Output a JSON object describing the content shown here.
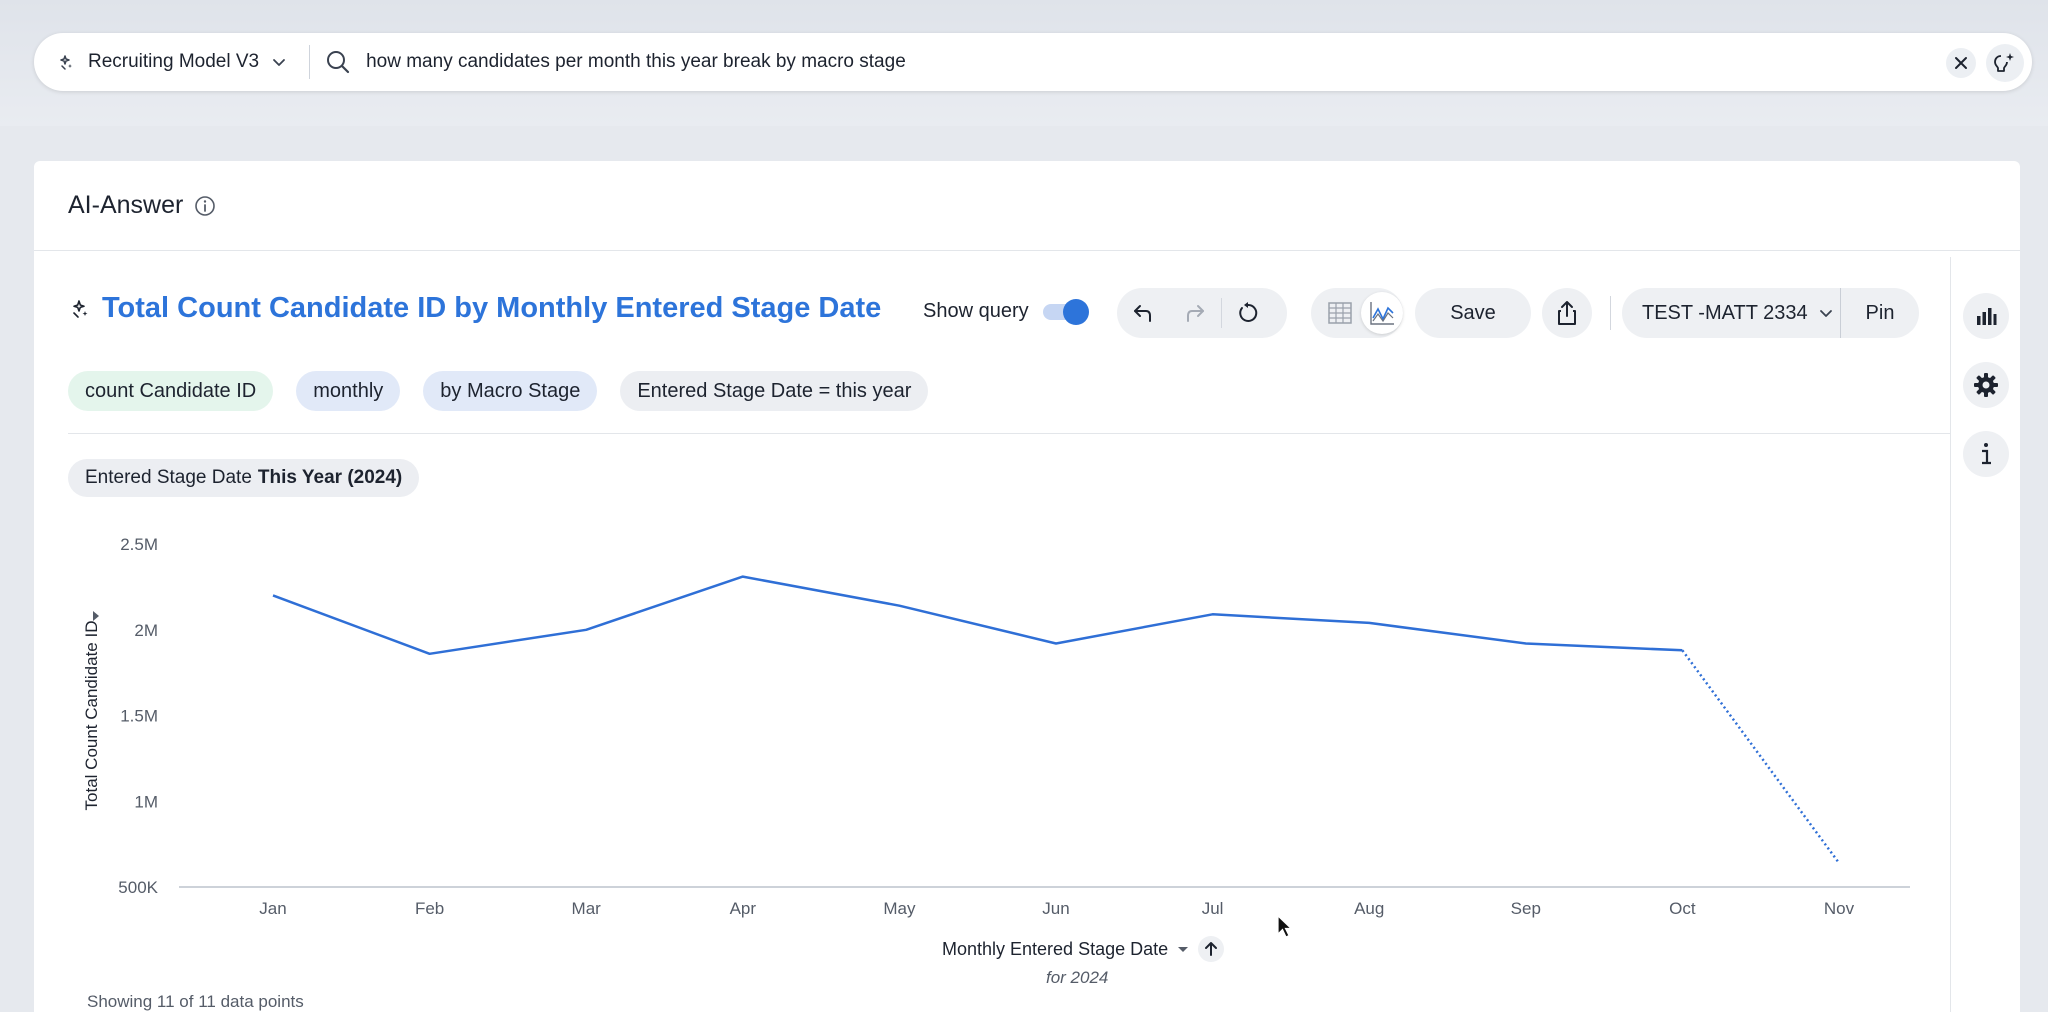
{
  "search": {
    "model_label": "Recruiting Model V3",
    "query": "how many candidates per month this year break by macro stage"
  },
  "card": {
    "title": "AI-Answer"
  },
  "answer": {
    "title": "Total Count Candidate ID by Monthly Entered Stage Date",
    "show_query_label": "Show query",
    "show_query_on": true,
    "save_label": "Save",
    "workspace_label": "TEST -MATT 2334",
    "pin_label": "Pin",
    "tokens": [
      {
        "label": "count Candidate ID",
        "kind": "measure"
      },
      {
        "label": "monthly",
        "kind": "attr"
      },
      {
        "label": "by Macro Stage",
        "kind": "attr"
      },
      {
        "label": "Entered Stage Date = this year",
        "kind": "filter"
      }
    ],
    "filter_chip_prefix": "Entered Stage Date",
    "filter_chip_value": "This Year (2024)",
    "x_axis_title": "Monthly Entered Stage Date",
    "x_axis_subtitle": "for 2024",
    "points_note": "Showing 11 of 11 data points"
  },
  "colors": {
    "accent": "#2d74da",
    "line": "#2f6fd6",
    "measure_token": "#e4f5ec",
    "attr_token": "#e1e9f8"
  },
  "chart_data": {
    "type": "line",
    "categories": [
      "Jan",
      "Feb",
      "Mar",
      "Apr",
      "May",
      "Jun",
      "Jul",
      "Aug",
      "Sep",
      "Oct",
      "Nov"
    ],
    "series": [
      {
        "values": [
          2200000,
          1860000,
          2000000,
          2310000,
          2140000,
          1920000,
          2090000,
          2040000,
          1920000,
          1880000,
          640000
        ]
      }
    ],
    "ylabel": "Total Count Candidate ID",
    "xlabel": "Monthly Entered Stage Date",
    "y_ticks": [
      "2.5M",
      "2M",
      "1.5M",
      "1M",
      "500K"
    ],
    "y_tick_values": [
      2500000,
      2000000,
      1500000,
      1000000,
      500000
    ],
    "ylim": [
      500000,
      2500000
    ],
    "dotted_last_segment": true,
    "grid": false
  },
  "icons": {
    "model": "sparkle-icon",
    "search": "search-icon",
    "clear": "close-icon",
    "ai": "ai-sparkle-bulb-icon",
    "info": "info-icon",
    "undo": "undo-icon",
    "redo": "redo-icon",
    "reset": "reset-icon",
    "table": "table-icon",
    "chart": "line-chart-icon",
    "share": "share-icon",
    "chart_type": "bar-chart-icon",
    "settings": "gear-icon",
    "details": "info-letter-icon"
  }
}
